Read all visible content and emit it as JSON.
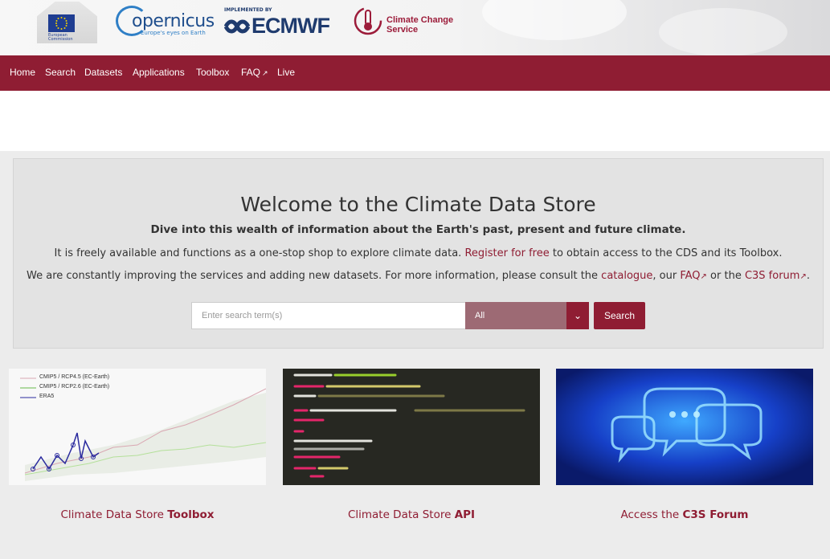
{
  "header": {
    "eu_text": "European Commission",
    "copernicus_name": "opernicus",
    "copernicus_tagline": "Europe's eyes on Earth",
    "ecmwf_small": "IMPLEMENTED BY",
    "ecmwf_name": "ECMWF",
    "c3s_line1": "Climate Change",
    "c3s_line2": "Service"
  },
  "nav": {
    "home": "Home",
    "search": "Search",
    "datasets": "Datasets",
    "applications": "Applications",
    "toolbox": "Toolbox",
    "faq": "FAQ",
    "live": "Live"
  },
  "hero": {
    "title": "Welcome to the Climate Data Store",
    "subtitle": "Dive into this wealth of information about the Earth's past, present and future climate.",
    "line1_pre": "It is freely available and functions as a one-stop shop to explore climate data. ",
    "line1_link": "Register for free",
    "line1_post": " to obtain access to the CDS and its Toolbox.",
    "line2_pre": "We are constantly improving the services and adding new datasets. For more information, please consult the ",
    "line2_link1": "catalogue",
    "line2_mid1": ", our ",
    "line2_link2": "FAQ",
    "line2_mid2": " or the ",
    "line2_link3": "C3S forum",
    "line2_end": "."
  },
  "search": {
    "placeholder": "Enter search term(s)",
    "select_value": "All",
    "button_label": "Search"
  },
  "cards": [
    {
      "label_pre": "Climate Data Store ",
      "label_bold": "Toolbox",
      "legend": [
        "CMIP5 / RCP4.5 (EC-Earth)",
        "CMIP5 / RCP2.6 (EC-Earth)",
        "ERA5"
      ]
    },
    {
      "label_pre": "Climate Data Store ",
      "label_bold": "API"
    },
    {
      "label_pre": "Access the ",
      "label_bold": "C3S Forum"
    }
  ],
  "colors": {
    "brand": "#8f1d33",
    "select_bg": "#9d6a74",
    "hero_bg": "#e3e3e3"
  }
}
